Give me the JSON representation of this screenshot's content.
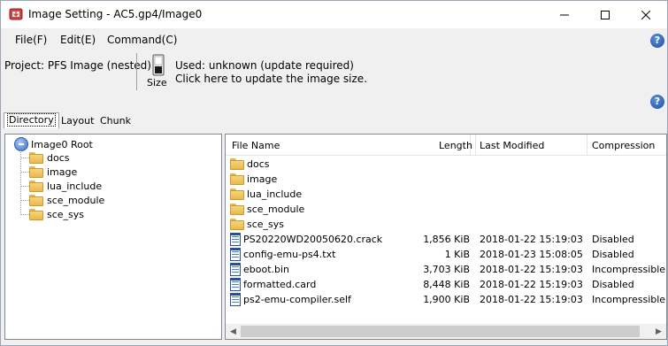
{
  "window": {
    "title": "Image Setting - AC5.gp4/Image0"
  },
  "menu": {
    "items": [
      {
        "label": "File(F)"
      },
      {
        "label": "Edit(E)"
      },
      {
        "label": "Command(C)"
      }
    ],
    "help_glyph": "?"
  },
  "project": {
    "label": "Project: PFS Image (nested)",
    "size_label": "Size",
    "used_text": "Used: unknown (update required)",
    "update_text": "Click here to update the image size.",
    "help_glyph": "?"
  },
  "tabs": [
    {
      "label": "Directory",
      "active": true
    },
    {
      "label": "Layout",
      "active": false
    },
    {
      "label": "Chunk",
      "active": false
    }
  ],
  "tree": {
    "root": "Image0 Root",
    "children": [
      "docs",
      "image",
      "lua_include",
      "sce_module",
      "sce_sys"
    ]
  },
  "list": {
    "columns": {
      "name": "File Name",
      "length": "Length",
      "modified": "Last Modified",
      "compression": "Compression"
    },
    "rows": [
      {
        "type": "folder",
        "name": "docs",
        "length": "",
        "modified": "",
        "compression": ""
      },
      {
        "type": "folder",
        "name": "image",
        "length": "",
        "modified": "",
        "compression": ""
      },
      {
        "type": "folder",
        "name": "lua_include",
        "length": "",
        "modified": "",
        "compression": ""
      },
      {
        "type": "folder",
        "name": "sce_module",
        "length": "",
        "modified": "",
        "compression": ""
      },
      {
        "type": "folder",
        "name": "sce_sys",
        "length": "",
        "modified": "",
        "compression": ""
      },
      {
        "type": "file",
        "name": "PS20220WD20050620.crack",
        "length": "1,856 KiB",
        "modified": "2018-01-22 15:19:03",
        "compression": "Disabled"
      },
      {
        "type": "file",
        "name": "config-emu-ps4.txt",
        "length": "1 KiB",
        "modified": "2018-01-23 15:08:05",
        "compression": "Disabled"
      },
      {
        "type": "file",
        "name": "eboot.bin",
        "length": "3,703 KiB",
        "modified": "2018-01-22 15:19:03",
        "compression": "Incompressible"
      },
      {
        "type": "file",
        "name": "formatted.card",
        "length": "8,448 KiB",
        "modified": "2018-01-22 15:19:03",
        "compression": "Disabled"
      },
      {
        "type": "file",
        "name": "ps2-emu-compiler.self",
        "length": "1,900 KiB",
        "modified": "2018-01-22 15:19:03",
        "compression": "Incompressible"
      }
    ]
  },
  "colors": {
    "folder": "#e7b949",
    "help_icon": "#1c4fa3",
    "file_icon": "#2a4fa0"
  }
}
